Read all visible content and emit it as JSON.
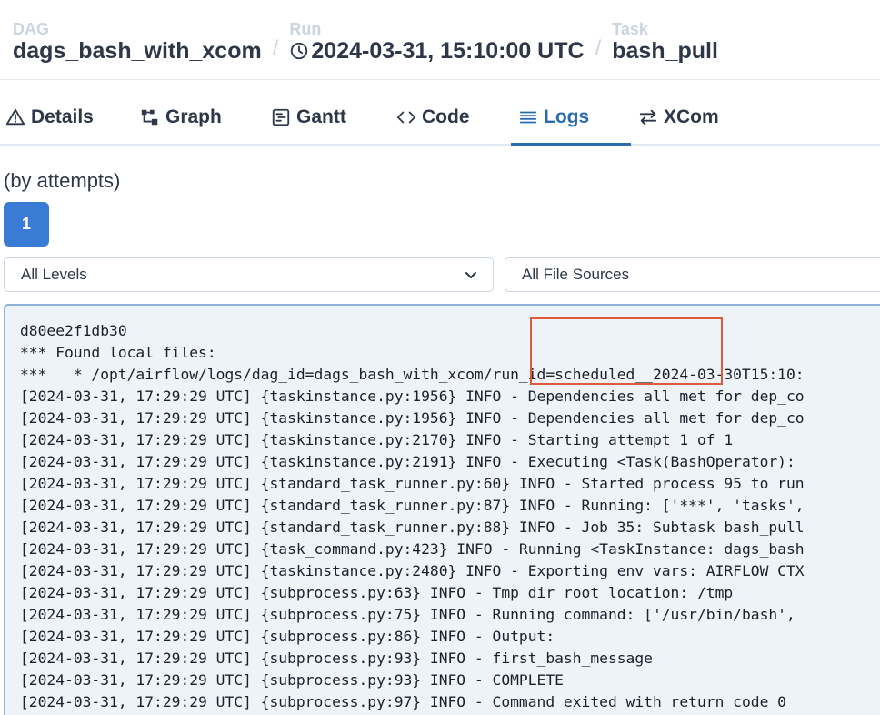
{
  "breadcrumb": {
    "dag_label": "DAG",
    "dag_value": "dags_bash_with_xcom",
    "run_label": "Run",
    "run_value": "2024-03-31, 15:10:00 UTC",
    "task_label": "Task",
    "task_value": "bash_pull",
    "separator": "/"
  },
  "tabs": [
    {
      "label": "Details",
      "icon": "warning-icon"
    },
    {
      "label": "Graph",
      "icon": "graph-icon"
    },
    {
      "label": "Gantt",
      "icon": "gantt-icon"
    },
    {
      "label": "Code",
      "icon": "code-icon"
    },
    {
      "label": "Logs",
      "icon": "list-icon",
      "active": true
    },
    {
      "label": "XCom",
      "icon": "swap-icon"
    }
  ],
  "attempts": {
    "label": "(by attempts)",
    "selected": "1"
  },
  "filters": {
    "level": "All Levels",
    "source": "All File Sources"
  },
  "log": {
    "lines": [
      "d80ee2f1db30",
      "*** Found local files:",
      "***   * /opt/airflow/logs/dag_id=dags_bash_with_xcom/run_id=scheduled__2024-03-30T15:10:",
      "[2024-03-31, 17:29:29 UTC] {taskinstance.py:1956} INFO - Dependencies all met for dep_co",
      "[2024-03-31, 17:29:29 UTC] {taskinstance.py:1956} INFO - Dependencies all met for dep_co",
      "[2024-03-31, 17:29:29 UTC] {taskinstance.py:2170} INFO - Starting attempt 1 of 1",
      "[2024-03-31, 17:29:29 UTC] {taskinstance.py:2191} INFO - Executing <Task(BashOperator):",
      "[2024-03-31, 17:29:29 UTC] {standard_task_runner.py:60} INFO - Started process 95 to run",
      "[2024-03-31, 17:29:29 UTC] {standard_task_runner.py:87} INFO - Running: ['***', 'tasks',",
      "[2024-03-31, 17:29:29 UTC] {standard_task_runner.py:88} INFO - Job 35: Subtask bash_pull",
      "[2024-03-31, 17:29:29 UTC] {task_command.py:423} INFO - Running <TaskInstance: dags_bash",
      "[2024-03-31, 17:29:29 UTC] {taskinstance.py:2480} INFO - Exporting env vars: AIRFLOW_CTX",
      "[2024-03-31, 17:29:29 UTC] {subprocess.py:63} INFO - Tmp dir root location: /tmp",
      "[2024-03-31, 17:29:29 UTC] {subprocess.py:75} INFO - Running command: ['/usr/bin/bash',",
      "[2024-03-31, 17:29:29 UTC] {subprocess.py:86} INFO - Output:",
      "[2024-03-31, 17:29:29 UTC] {subprocess.py:93} INFO - first_bash_message",
      "[2024-03-31, 17:29:29 UTC] {subprocess.py:93} INFO - COMPLETE",
      "[2024-03-31, 17:29:29 UTC] {subprocess.py:97} INFO - Command exited with return code 0"
    ]
  },
  "colors": {
    "accent": "#2b6cb0",
    "attempt_button": "#3a7bd5",
    "highlight": "#e05a3a",
    "log_background": "#eef3f8"
  }
}
